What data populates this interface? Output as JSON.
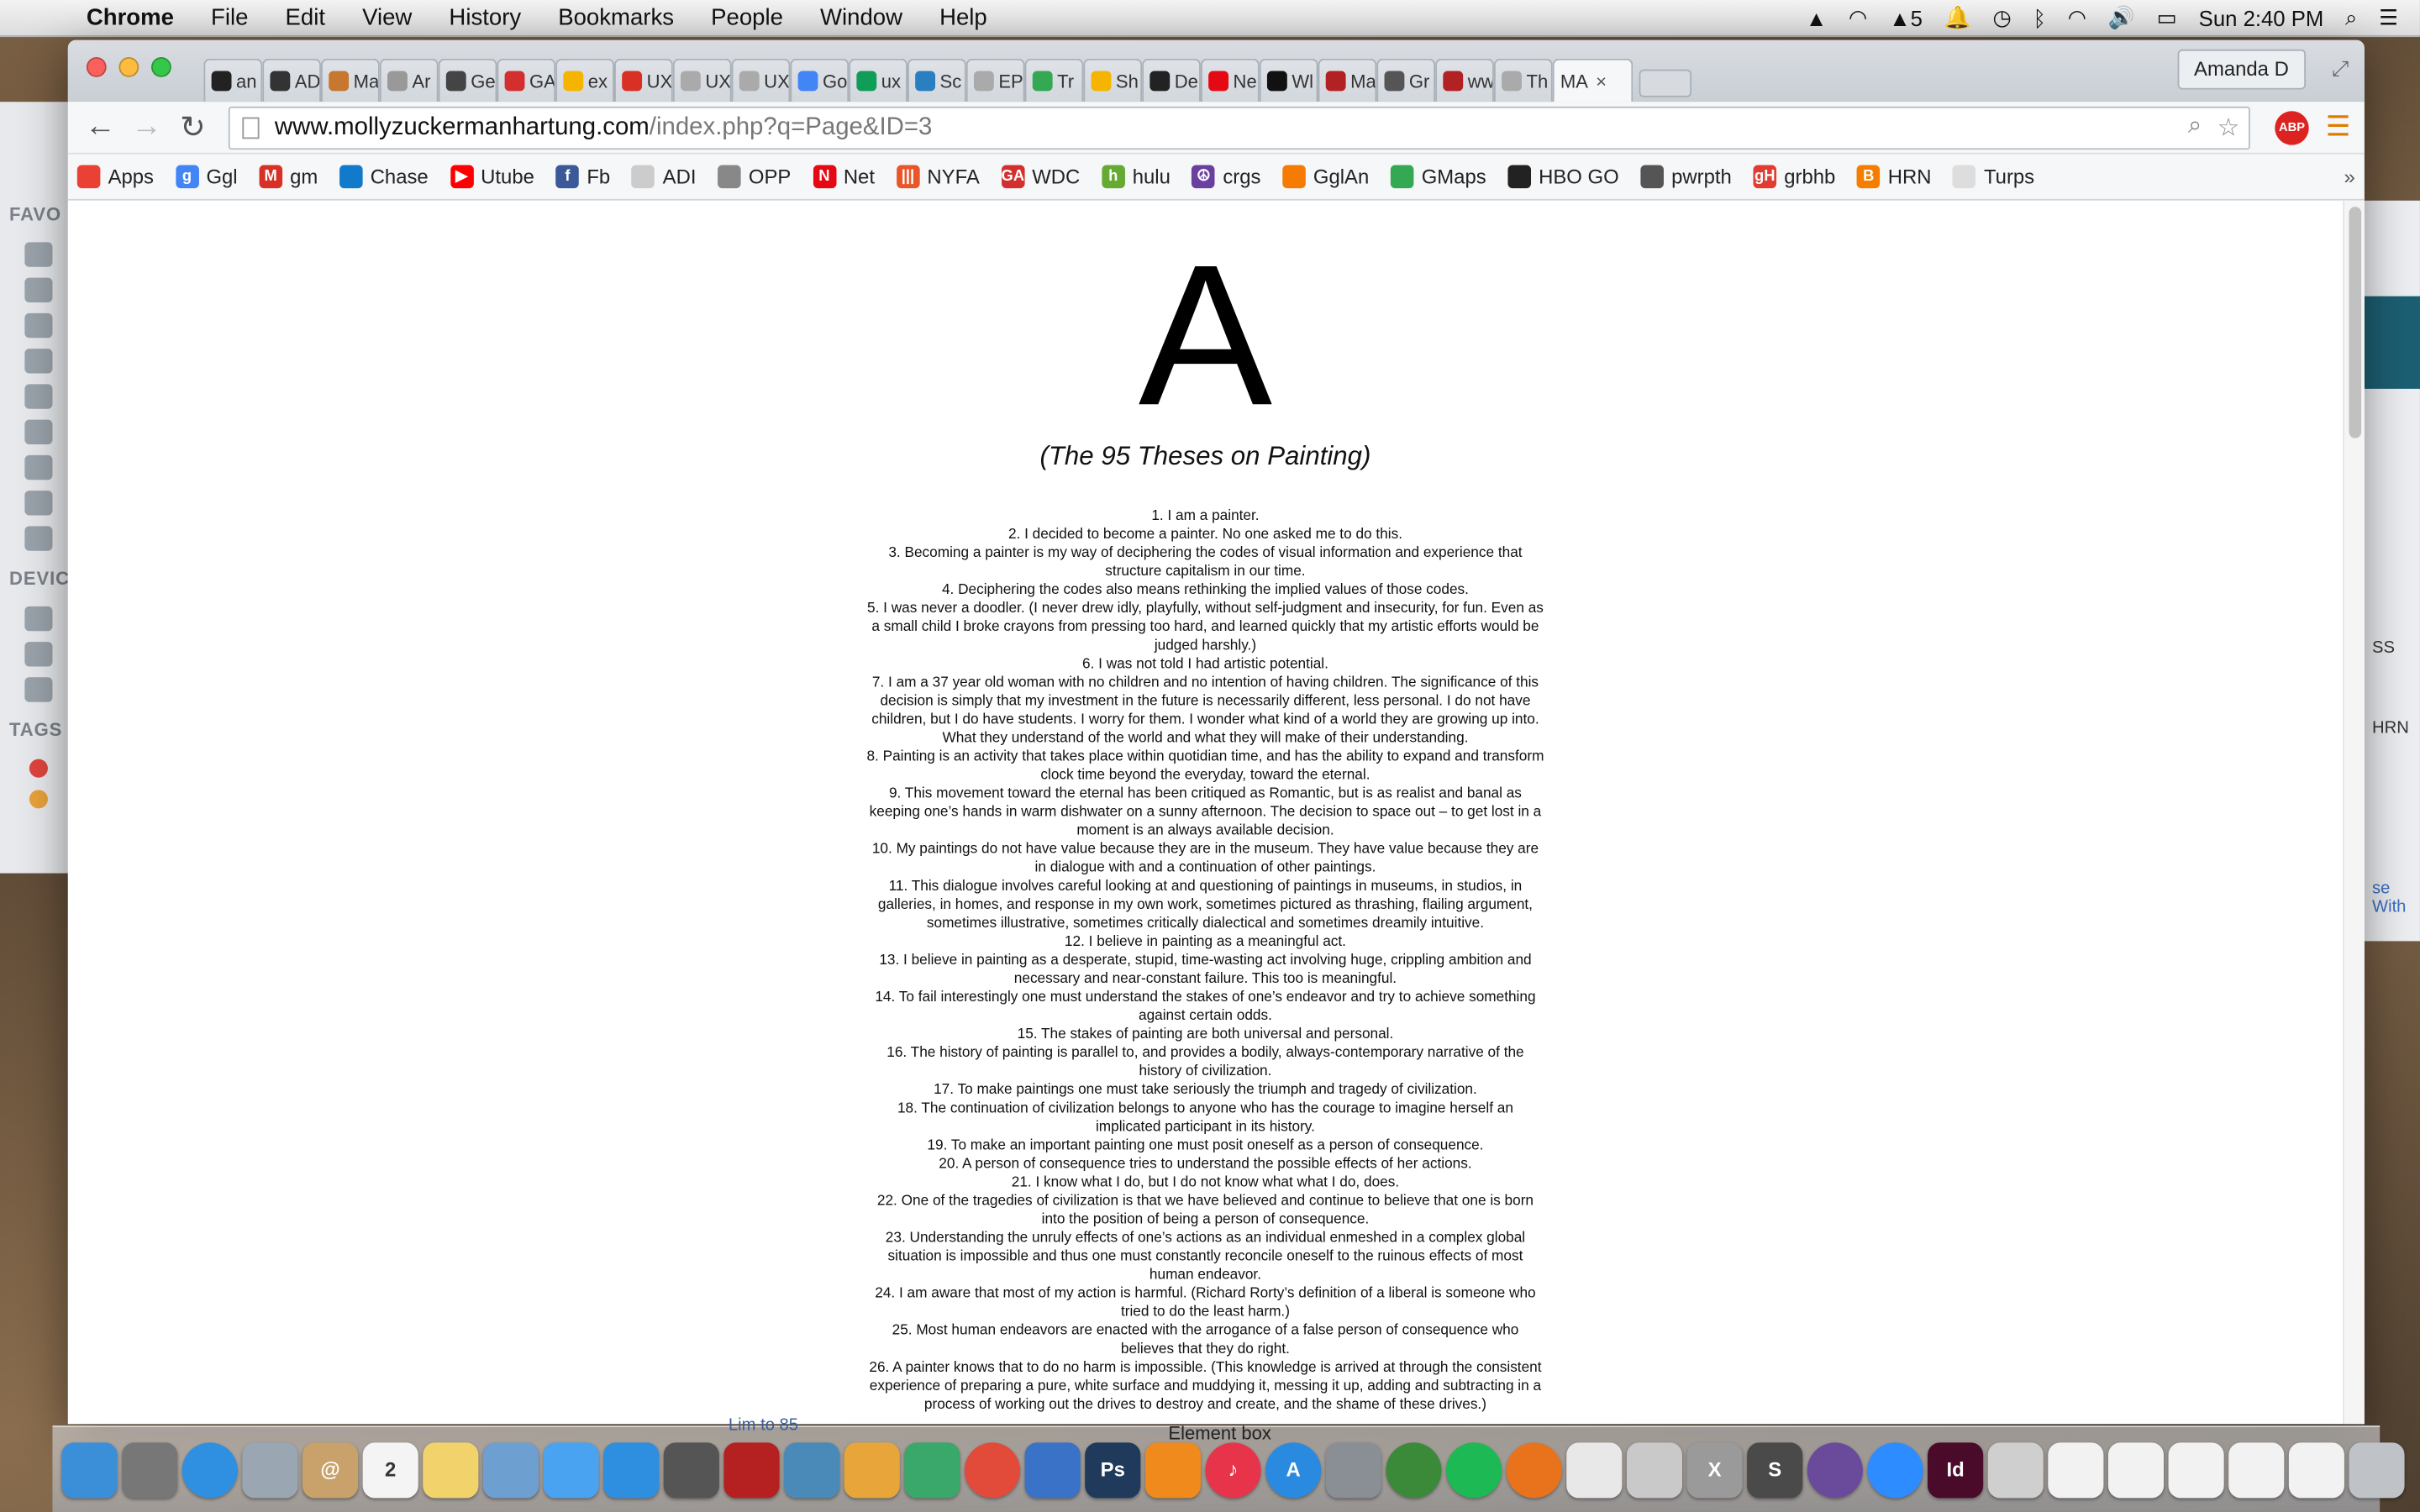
{
  "menubar": {
    "app": "Chrome",
    "items": [
      "File",
      "Edit",
      "View",
      "History",
      "Bookmarks",
      "People",
      "Window",
      "Help"
    ],
    "adobe_count": "5",
    "clock": "Sun 2:40 PM"
  },
  "finder": {
    "favorites": "FAVO",
    "devices": "DEVIC",
    "tags": "TAGS"
  },
  "bg_window": {
    "label1": "SS",
    "label2": "HRN",
    "label3": "se With"
  },
  "tabs": [
    {
      "label": "an",
      "color": "#222222"
    },
    {
      "label": "AD",
      "color": "#333333"
    },
    {
      "label": "Ma",
      "color": "#c8772e"
    },
    {
      "label": "Ar",
      "color": "#999999"
    },
    {
      "label": "Ge",
      "color": "#444444"
    },
    {
      "label": "GA",
      "color": "#d32f2f"
    },
    {
      "label": "ex",
      "color": "#f4b400"
    },
    {
      "label": "UX",
      "color": "#d93025"
    },
    {
      "label": "UX",
      "color": "#aaaaaa"
    },
    {
      "label": "UX",
      "color": "#aaaaaa"
    },
    {
      "label": "Go",
      "color": "#4285f4"
    },
    {
      "label": "ux",
      "color": "#0f9d58"
    },
    {
      "label": "Sc",
      "color": "#2a7fc1"
    },
    {
      "label": "EP",
      "color": "#aaaaaa"
    },
    {
      "label": "Tr",
      "color": "#34a853"
    },
    {
      "label": "Sh",
      "color": "#f4b400"
    },
    {
      "label": "De",
      "color": "#222222"
    },
    {
      "label": "Ne",
      "color": "#e50914"
    },
    {
      "label": "Wl",
      "color": "#111111"
    },
    {
      "label": "Ma",
      "color": "#b22222"
    },
    {
      "label": "Gr",
      "color": "#555555"
    },
    {
      "label": "ww",
      "color": "#b22222"
    },
    {
      "label": "Th",
      "color": "#aaaaaa"
    }
  ],
  "active_tab": {
    "label": "MA",
    "close": "×"
  },
  "profile_name": "Amanda D",
  "address": {
    "host": "www.mollyzuckermanhartung.com",
    "path": "/index.php?q=Page&ID=3"
  },
  "abp_label": "ABP",
  "bookmarks": [
    {
      "label": "Apps",
      "icon": "apps-icon",
      "color": "#e94235",
      "glyph": ""
    },
    {
      "label": "Ggl",
      "icon": "google-icon",
      "color": "#4285f4",
      "glyph": "g"
    },
    {
      "label": "gm",
      "icon": "gmail-icon",
      "color": "#d93025",
      "glyph": "M"
    },
    {
      "label": "Chase",
      "icon": "chase-icon",
      "color": "#117aca",
      "glyph": ""
    },
    {
      "label": "Utube",
      "icon": "youtube-icon",
      "color": "#ff0000",
      "glyph": "▶"
    },
    {
      "label": "Fb",
      "icon": "facebook-icon",
      "color": "#3b5998",
      "glyph": "f"
    },
    {
      "label": "ADI",
      "icon": "page-icon",
      "color": "#cccccc",
      "glyph": ""
    },
    {
      "label": "OPP",
      "icon": "key-icon",
      "color": "#888888",
      "glyph": ""
    },
    {
      "label": "Net",
      "icon": "netflix-icon",
      "color": "#e50914",
      "glyph": "N"
    },
    {
      "label": "NYFA",
      "icon": "nyfa-icon",
      "color": "#e8562a",
      "glyph": "|||"
    },
    {
      "label": "WDC",
      "icon": "ga-icon",
      "color": "#d32f2f",
      "glyph": "GA"
    },
    {
      "label": "hulu",
      "icon": "hulu-icon",
      "color": "#66aa33",
      "glyph": "h"
    },
    {
      "label": "crgs",
      "icon": "peace-icon",
      "color": "#6a3fa0",
      "glyph": "☮"
    },
    {
      "label": "GglAn",
      "icon": "analytics-icon",
      "color": "#f57c00",
      "glyph": ""
    },
    {
      "label": "GMaps",
      "icon": "maps-icon",
      "color": "#34a853",
      "glyph": ""
    },
    {
      "label": "HBO GO",
      "icon": "hbo-icon",
      "color": "#222222",
      "glyph": ""
    },
    {
      "label": "pwrpth",
      "icon": "powerpath-icon",
      "color": "#555555",
      "glyph": ""
    },
    {
      "label": "grbhb",
      "icon": "grubhub-icon",
      "color": "#e03c31",
      "glyph": "gH"
    },
    {
      "label": "HRN",
      "icon": "blogger-icon",
      "color": "#f57d00",
      "glyph": "B"
    },
    {
      "label": "Turps",
      "icon": "page-icon",
      "color": "#dddddd",
      "glyph": ""
    }
  ],
  "page": {
    "letter": "A",
    "subtitle": "(The 95 Theses on Painting)",
    "theses": [
      "1. I am a painter.",
      "2. I decided to become a painter. No one asked me to do this.",
      "3. Becoming a painter is my way of deciphering the codes of visual information and experience that structure capitalism in our time.",
      "4. Deciphering the codes also means rethinking the implied values of those codes.",
      "5. I was never a doodler. (I never drew idly, playfully, without self-judgment and insecurity, for fun. Even as a small child I broke crayons from pressing too hard, and learned quickly that my artistic efforts would be judged harshly.)",
      "6. I was not told I had artistic potential.",
      "7. I am a 37 year old woman with no children and no intention of having children. The significance of this decision is simply that my investment in the future is necessarily different, less personal. I do not have children, but I do have students. I worry for them. I wonder what kind of a world they are growing up into. What they understand of the world and what they will make of their understanding.",
      "8. Painting is an activity that takes place within quotidian time, and has the ability to expand and transform clock time beyond the everyday, toward the eternal.",
      "9. This movement toward the eternal has been critiqued as Romantic, but is as realist and banal as keeping one’s hands in warm dishwater on a sunny afternoon. The decision to space out – to get lost in a moment is an always available decision.",
      "10. My paintings do not have value because they are in the museum. They have value because they are in dialogue with and a continuation of other paintings.",
      "11. This dialogue involves careful looking at and questioning of paintings in museums, in studios, in galleries, in homes, and response in my own work, sometimes pictured as thrashing, flailing argument, sometimes illustrative, sometimes critically dialectical and sometimes dreamily intuitive.",
      "12. I believe in painting as a meaningful act.",
      "13. I believe in painting as a desperate, stupid, time-wasting act involving huge, crippling ambition and necessary and near-constant failure. This too is meaningful.",
      "14. To fail interestingly one must understand the stakes of one’s endeavor and try to achieve something against certain odds.",
      "15. The stakes of painting are both universal and personal.",
      "16. The history of painting is parallel to, and provides a bodily, always-contemporary narrative of the history of civilization.",
      "17. To make paintings one must take seriously the triumph and tragedy of civilization.",
      "18. The continuation of civilization belongs to anyone who has the courage to imagine herself an implicated participant in its history.",
      "19. To make an important painting one must posit oneself as a person of consequence.",
      "20. A person of consequence tries to understand the possible effects of her actions.",
      "21. I know what I do, but I do not know what what I do, does.",
      "22. One of the tragedies of civilization is that we have believed and continue to believe that one is born into the position of being a person of consequence.",
      "23. Understanding the unruly effects of one’s actions as an individual enmeshed in a complex global situation is impossible and thus one must constantly reconcile oneself to the ruinous effects of most human endeavor.",
      "24. I am aware that most of my action is harmful. (Richard Rorty’s definition of a liberal is someone who tried to do the least harm.)",
      "25. Most human endeavors are enacted with the arrogance of a false person of consequence who believes that they do right.",
      "26. A painter knows that to do no harm is impossible. (This knowledge is arrived at through the consistent experience of preparing a pure, white surface and muddying it, messing it up, adding and subtracting in a process of working out the drives to destroy and create, and the shame of these drives.)"
    ]
  },
  "dock": {
    "hover_label": "Element box",
    "faint_label": "Lim to 85",
    "calendar_day": "2",
    "icons": [
      {
        "name": "finder-icon",
        "color": "#3b8fd9",
        "glyph": ""
      },
      {
        "name": "launchpad-icon",
        "color": "#777777",
        "glyph": ""
      },
      {
        "name": "safari-icon",
        "color": "#2f8fe0",
        "glyph": ""
      },
      {
        "name": "mail-icon",
        "color": "#9aa7b3",
        "glyph": ""
      },
      {
        "name": "contacts-icon",
        "color": "#c8a26a",
        "glyph": "@"
      },
      {
        "name": "calendar-icon",
        "color": "#f4f4f4",
        "glyph": "2"
      },
      {
        "name": "notes-icon",
        "color": "#f2d36b",
        "glyph": ""
      },
      {
        "name": "preview-icon",
        "color": "#6e9fd1",
        "glyph": ""
      },
      {
        "name": "messages-icon",
        "color": "#4aa3f0",
        "glyph": ""
      },
      {
        "name": "dropbox-icon",
        "color": "#2e8fe0",
        "glyph": ""
      },
      {
        "name": "facetime-icon",
        "color": "#555555",
        "glyph": ""
      },
      {
        "name": "photo-booth-icon",
        "color": "#b52020",
        "glyph": ""
      },
      {
        "name": "iphoto-icon",
        "color": "#4a8ab8",
        "glyph": ""
      },
      {
        "name": "pages-icon",
        "color": "#e8a63a",
        "glyph": ""
      },
      {
        "name": "numbers-icon",
        "color": "#3aa86a",
        "glyph": ""
      },
      {
        "name": "chrome-icon",
        "color": "#e24a3a",
        "glyph": ""
      },
      {
        "name": "keynote-icon",
        "color": "#3a72c8",
        "glyph": ""
      },
      {
        "name": "photoshop-icon",
        "color": "#1f3a5a",
        "glyph": "Ps"
      },
      {
        "name": "ibooks-icon",
        "color": "#f08a1c",
        "glyph": ""
      },
      {
        "name": "itunes-icon",
        "color": "#e8344a",
        "glyph": "♪"
      },
      {
        "name": "app-store-icon",
        "color": "#2a8ae0",
        "glyph": "A"
      },
      {
        "name": "system-prefs-icon",
        "color": "#8a8f96",
        "glyph": ""
      },
      {
        "name": "globe-icon",
        "color": "#3a8a3a",
        "glyph": ""
      },
      {
        "name": "spotify-icon",
        "color": "#1db954",
        "glyph": ""
      },
      {
        "name": "firefox-icon",
        "color": "#e8731c",
        "glyph": ""
      },
      {
        "name": "textedit-icon",
        "color": "#e8e8e8",
        "glyph": ""
      },
      {
        "name": "preview2-icon",
        "color": "#c9c9c9",
        "glyph": ""
      },
      {
        "name": "x11-icon",
        "color": "#9a9a9a",
        "glyph": "X"
      },
      {
        "name": "sublime-icon",
        "color": "#4a4a4a",
        "glyph": "S"
      },
      {
        "name": "github-icon",
        "color": "#6a4a9a",
        "glyph": ""
      },
      {
        "name": "zoom-icon",
        "color": "#2d8cff",
        "glyph": ""
      },
      {
        "name": "indesign-icon",
        "color": "#4a0a2a",
        "glyph": "Id"
      },
      {
        "name": "downloads-icon",
        "color": "#cfcfcf",
        "glyph": ""
      },
      {
        "name": "doc1-icon",
        "color": "#f2f2f2",
        "glyph": ""
      },
      {
        "name": "doc2-icon",
        "color": "#f2f2f2",
        "glyph": ""
      },
      {
        "name": "doc3-icon",
        "color": "#f2f2f2",
        "glyph": ""
      },
      {
        "name": "doc4-icon",
        "color": "#f2f2f2",
        "glyph": ""
      },
      {
        "name": "doc5-icon",
        "color": "#f2f2f2",
        "glyph": ""
      },
      {
        "name": "trash-icon",
        "color": "#bfc3c7",
        "glyph": ""
      }
    ]
  }
}
